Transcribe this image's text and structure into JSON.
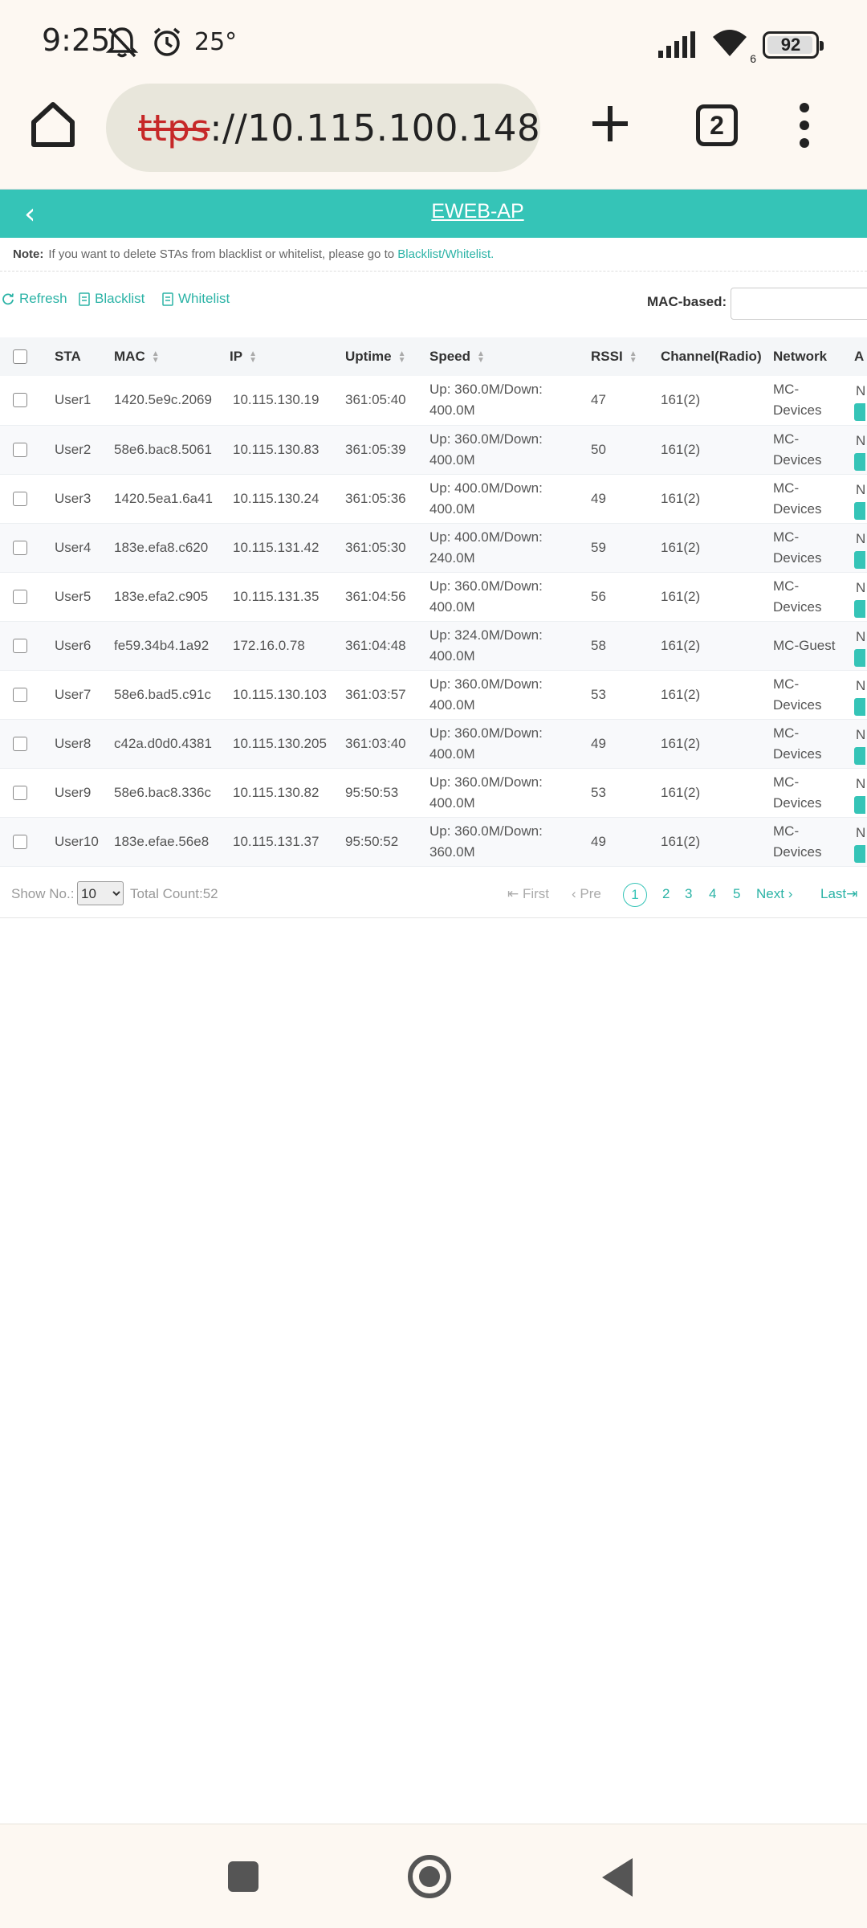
{
  "status_bar": {
    "time": "9:25",
    "temperature": "25°",
    "wifi_badge": "6",
    "battery": "92",
    "icons": [
      "mute-icon",
      "alarm-icon",
      "signal-icon",
      "wifi-icon",
      "battery-icon"
    ]
  },
  "browser": {
    "url_scheme": "ttps",
    "url_rest": "://10.115.100.148",
    "tab_count": "2"
  },
  "page": {
    "title": "EWEB-AP",
    "note_label": "Note:",
    "note_text": "If you want to delete STAs from blacklist or whitelist, please go to",
    "note_link": "Blacklist/Whitelist.",
    "toolbar": {
      "refresh": "Refresh",
      "blacklist": "Blacklist",
      "whitelist": "Whitelist",
      "mac_label": "MAC-based:",
      "mac_value": ""
    },
    "accent_color": "#35c4b7"
  },
  "table": {
    "headers": {
      "sta": "STA",
      "mac": "MAC",
      "ip": "IP",
      "uptime": "Uptime",
      "speed": "Speed",
      "rssi": "RSSI",
      "channel": "Channel(Radio)",
      "network": "Network",
      "action_cut": "A"
    },
    "rows": [
      {
        "sta": "User1",
        "mac": "1420.5e9c.2069",
        "ip": "10.115.130.19",
        "uptime": "361:05:40",
        "speed_up": "Up: 360.0M/Down:",
        "speed_down": "400.0M",
        "rssi": "47",
        "channel": "161(2)",
        "network_1": "MC-",
        "network_2": "Devices",
        "cut": "N"
      },
      {
        "sta": "User2",
        "mac": "58e6.bac8.5061",
        "ip": "10.115.130.83",
        "uptime": "361:05:39",
        "speed_up": "Up: 360.0M/Down:",
        "speed_down": "400.0M",
        "rssi": "50",
        "channel": "161(2)",
        "network_1": "MC-",
        "network_2": "Devices",
        "cut": "N"
      },
      {
        "sta": "User3",
        "mac": "1420.5ea1.6a41",
        "ip": "10.115.130.24",
        "uptime": "361:05:36",
        "speed_up": "Up: 400.0M/Down:",
        "speed_down": "400.0M",
        "rssi": "49",
        "channel": "161(2)",
        "network_1": "MC-",
        "network_2": "Devices",
        "cut": "N"
      },
      {
        "sta": "User4",
        "mac": "183e.efa8.c620",
        "ip": "10.115.131.42",
        "uptime": "361:05:30",
        "speed_up": "Up: 400.0M/Down:",
        "speed_down": "240.0M",
        "rssi": "59",
        "channel": "161(2)",
        "network_1": "MC-",
        "network_2": "Devices",
        "cut": "N"
      },
      {
        "sta": "User5",
        "mac": "183e.efa2.c905",
        "ip": "10.115.131.35",
        "uptime": "361:04:56",
        "speed_up": "Up: 360.0M/Down:",
        "speed_down": "400.0M",
        "rssi": "56",
        "channel": "161(2)",
        "network_1": "MC-",
        "network_2": "Devices",
        "cut": "N"
      },
      {
        "sta": "User6",
        "mac": "fe59.34b4.1a92",
        "ip": "172.16.0.78",
        "uptime": "361:04:48",
        "speed_up": "Up: 324.0M/Down:",
        "speed_down": "400.0M",
        "rssi": "58",
        "channel": "161(2)",
        "network_1": "MC-Guest",
        "network_2": "",
        "cut": "N"
      },
      {
        "sta": "User7",
        "mac": "58e6.bad5.c91c",
        "ip": "10.115.130.103",
        "uptime": "361:03:57",
        "speed_up": "Up: 360.0M/Down:",
        "speed_down": "400.0M",
        "rssi": "53",
        "channel": "161(2)",
        "network_1": "MC-",
        "network_2": "Devices",
        "cut": "N"
      },
      {
        "sta": "User8",
        "mac": "c42a.d0d0.4381",
        "ip": "10.115.130.205",
        "uptime": "361:03:40",
        "speed_up": "Up: 360.0M/Down:",
        "speed_down": "400.0M",
        "rssi": "49",
        "channel": "161(2)",
        "network_1": "MC-",
        "network_2": "Devices",
        "cut": "N"
      },
      {
        "sta": "User9",
        "mac": "58e6.bac8.336c",
        "ip": "10.115.130.82",
        "uptime": "95:50:53",
        "speed_up": "Up: 360.0M/Down:",
        "speed_down": "400.0M",
        "rssi": "53",
        "channel": "161(2)",
        "network_1": "MC-",
        "network_2": "Devices",
        "cut": "N"
      },
      {
        "sta": "User10",
        "mac": "183e.efae.56e8",
        "ip": "10.115.131.37",
        "uptime": "95:50:52",
        "speed_up": "Up: 360.0M/Down:",
        "speed_down": "360.0M",
        "rssi": "49",
        "channel": "161(2)",
        "network_1": "MC-",
        "network_2": "Devices",
        "cut": "N"
      }
    ]
  },
  "pagination": {
    "show_label": "Show No.:",
    "page_size": "10",
    "total": "Total Count:52",
    "first": "First",
    "prev": "Pre",
    "current": "1",
    "pages": [
      "2",
      "3",
      "4",
      "5"
    ],
    "next": "Next",
    "last": "Last"
  }
}
